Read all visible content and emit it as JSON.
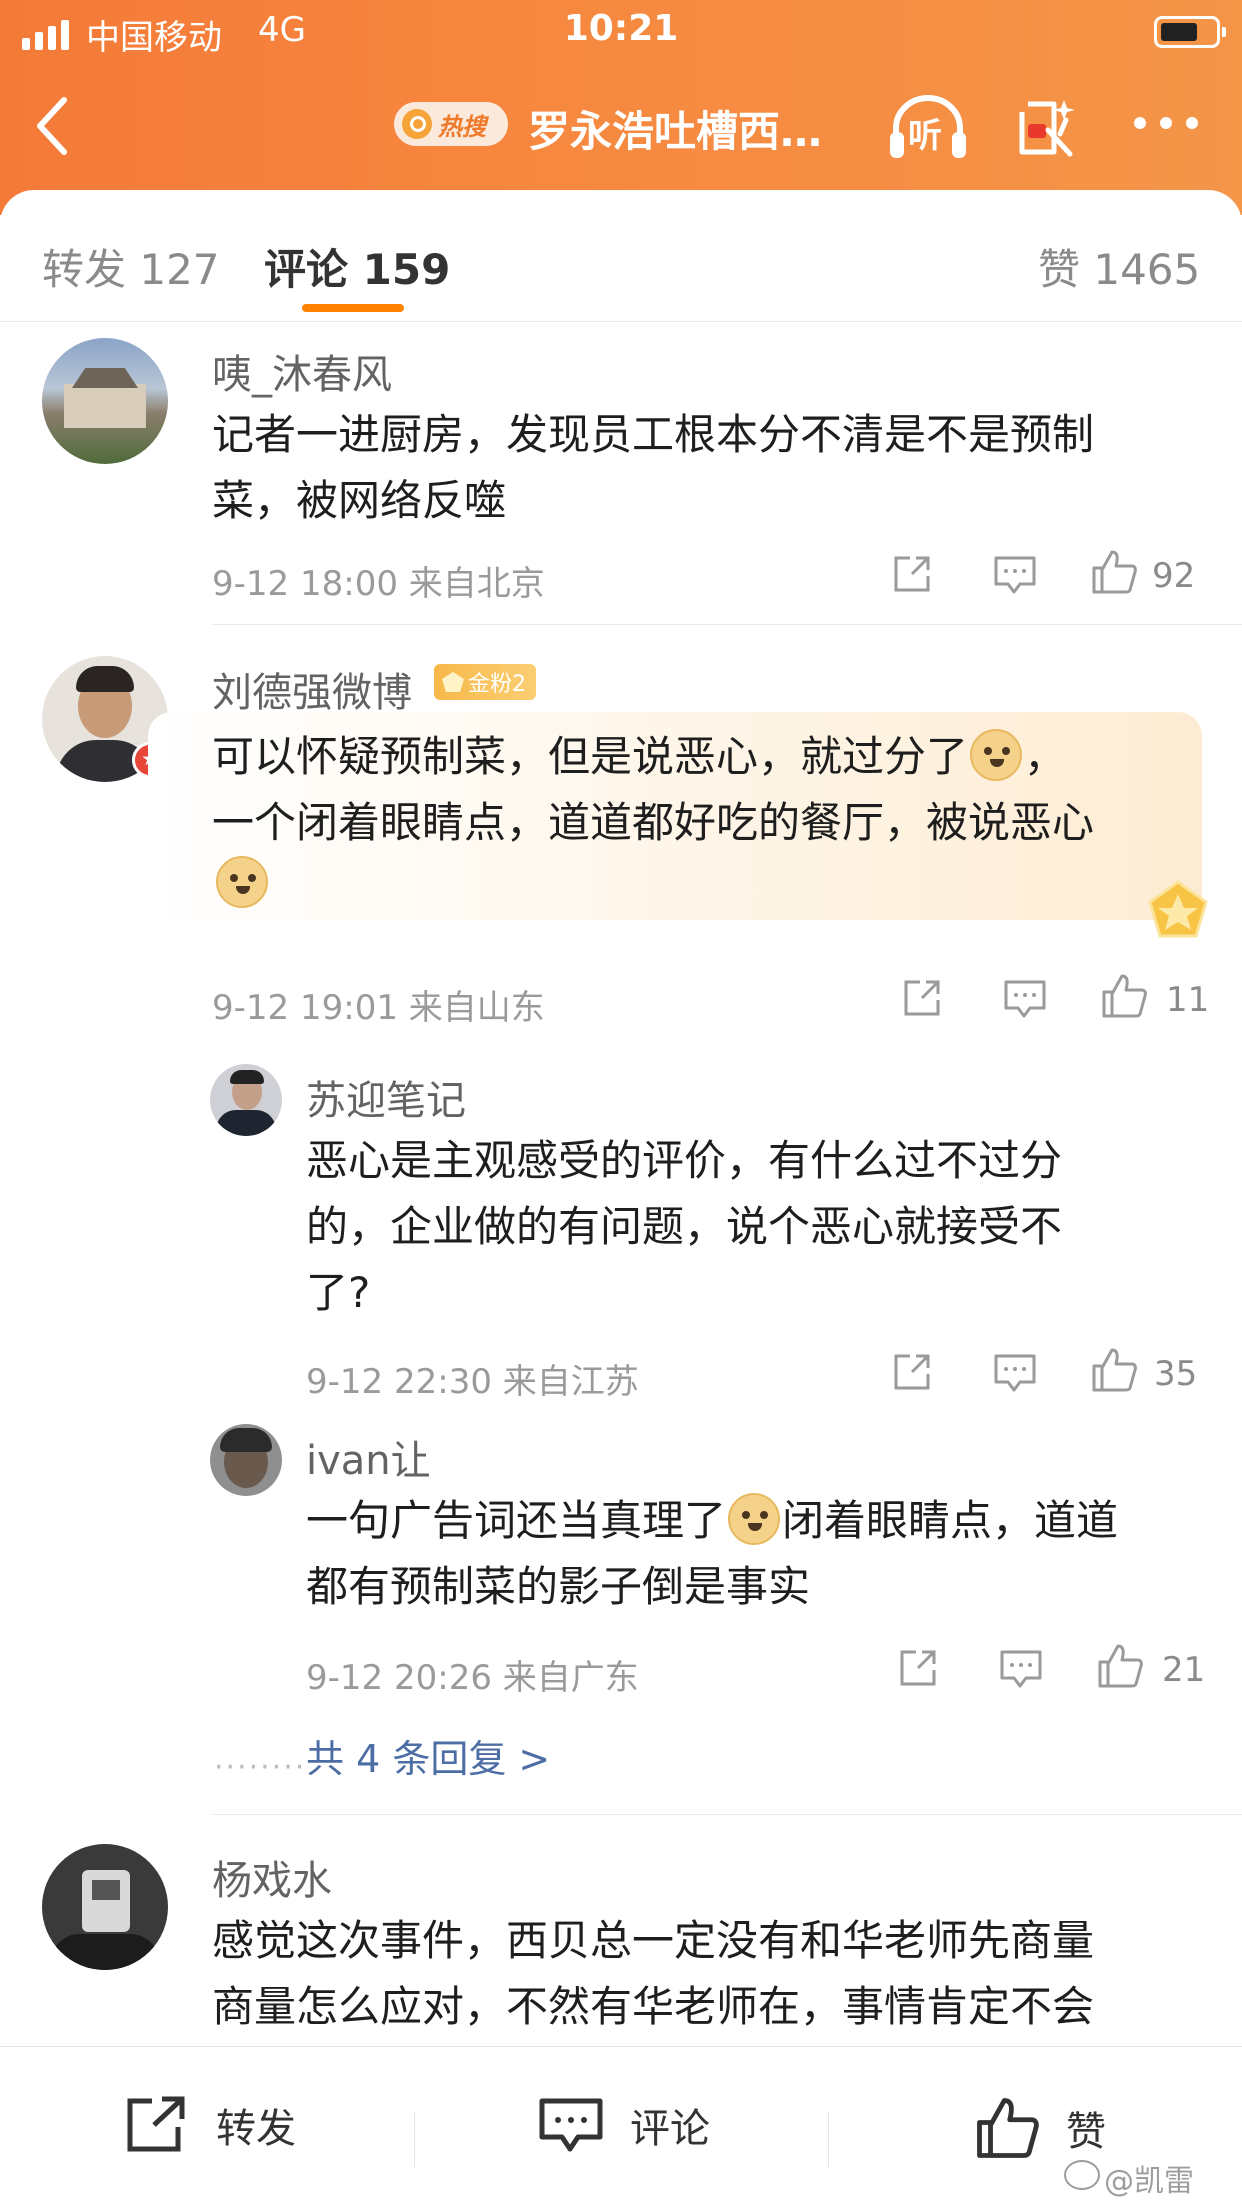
{
  "status_bar": {
    "carrier": "中国移动",
    "network": "4G",
    "time": "10:21"
  },
  "nav": {
    "hot_label": "热搜",
    "title": "罗永浩吐槽西…",
    "listen_label": "听"
  },
  "tabs": {
    "repost": "转发 127",
    "comment": "评论 159",
    "like": "赞 1465"
  },
  "comments": [
    {
      "user": "咦_沐春风",
      "text_lines": [
        "记者一进厨房，发现员工根本分不清是不是预制",
        "菜，被网络反噬"
      ],
      "time_loc": "9-12 18:00 来自北京",
      "likes": "92"
    },
    {
      "user": "刘德强微博",
      "badge": "金粉2",
      "text_line1": "可以怀疑预制菜，但是说恶心，就过分了",
      "text_line1_end": "，",
      "text_line2": "一个闭着眼睛点，道道都好吃的餐厅，被说恶心",
      "time_loc": "9-12 19:01 来自山东",
      "likes": "11",
      "replies": [
        {
          "user": "苏迎笔记",
          "text_lines": [
            "恶心是主观感受的评价，有什么过不过分",
            "的，企业做的有问题，说个恶心就接受不",
            "了?"
          ],
          "time_loc": "9-12 22:30 来自江苏",
          "likes": "35"
        },
        {
          "user": "ivan让",
          "text_line1a": "一句广告词还当真理了",
          "text_line1b": "闭着眼睛点，道道",
          "text_line2": "都有预制菜的影子倒是事实",
          "time_loc": "9-12 20:26 来自广东",
          "likes": "21"
        }
      ],
      "more_replies": "共 4 条回复 >"
    },
    {
      "user": "杨戏水",
      "text_lines": [
        "感觉这次事件，西贝总一定没有和华老师先商量",
        "商量怎么应对，不然有华老师在，事情肯定不会"
      ]
    }
  ],
  "toolbar": {
    "repost": "转发",
    "comment": "评论",
    "like": "赞"
  },
  "watermark": "@凯雷",
  "colors": {
    "header_orange": "#f6883f",
    "tab_underline": "#ff8200",
    "link_blue": "#4d6ea5"
  },
  "icons": [
    "back-icon",
    "search-icon",
    "headphone-icon",
    "red-packet-icon",
    "more-icon",
    "share-icon",
    "comment-icon",
    "like-icon",
    "doge-emoji-icon"
  ]
}
